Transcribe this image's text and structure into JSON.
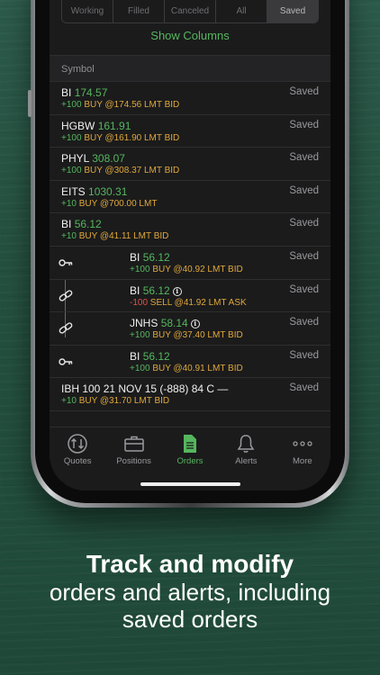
{
  "segments": [
    "Working",
    "Filled",
    "Canceled",
    "All",
    "Saved"
  ],
  "show_columns": "Show Columns",
  "section_header": "Symbol",
  "orders": [
    {
      "symbol": "BI",
      "price": "174.57",
      "qty": "+100",
      "action": "BUY @174.56 LMT BID",
      "status": "Saved",
      "icon": ""
    },
    {
      "symbol": "HGBW",
      "price": "161.91",
      "qty": "+100",
      "action": "BUY @161.90 LMT BID",
      "status": "Saved",
      "icon": ""
    },
    {
      "symbol": "PHYL",
      "price": "308.07",
      "qty": "+100",
      "action": "BUY @308.37 LMT BID",
      "status": "Saved",
      "icon": ""
    },
    {
      "symbol": "EITS",
      "price": "1030.31",
      "qty": "+10",
      "action": "BUY @700.00 LMT",
      "status": "Saved",
      "icon": ""
    },
    {
      "symbol": "BI",
      "price": "56.12",
      "qty": "+10",
      "action": "BUY @41.11 LMT BID",
      "status": "Saved",
      "icon": ""
    },
    {
      "symbol": "BI",
      "price": "56.12",
      "qty": "+100",
      "action": "BUY @40.92 LMT BID",
      "status": "Saved",
      "icon": "key-icon"
    },
    {
      "symbol": "BI",
      "price": "56.12",
      "qty": "-100",
      "action": "SELL @41.92 LMT ASK",
      "status": "Saved",
      "icon": "link-icon",
      "info": "i"
    },
    {
      "symbol": "JNHS",
      "price": "58.14",
      "qty": "+100",
      "action": "BUY @37.40 LMT BID",
      "status": "Saved",
      "icon": "link-icon",
      "info": "i"
    },
    {
      "symbol": "BI",
      "price": "56.12",
      "qty": "+100",
      "action": "BUY @40.91 LMT BID",
      "status": "Saved",
      "icon": "key-icon"
    },
    {
      "symbol": "IBH 100 21 NOV 15 (-888) 84 C —",
      "price": "",
      "qty": "+10",
      "action": "BUY @31.70 LMT BID",
      "status": "Saved",
      "icon": ""
    }
  ],
  "tabs": [
    {
      "label": "Quotes",
      "icon": "quotes-icon"
    },
    {
      "label": "Positions",
      "icon": "briefcase-icon"
    },
    {
      "label": "Orders",
      "icon": "document-icon"
    },
    {
      "label": "Alerts",
      "icon": "bell-icon"
    },
    {
      "label": "More",
      "icon": "more-dots-icon"
    }
  ],
  "caption": {
    "line1": "Track and modify",
    "line2": "orders and alerts, including",
    "line3": "saved orders"
  },
  "colors": {
    "accent": "#55b65e",
    "action": "#e0a83a",
    "negative": "#e0524a",
    "background": "#24503f"
  }
}
